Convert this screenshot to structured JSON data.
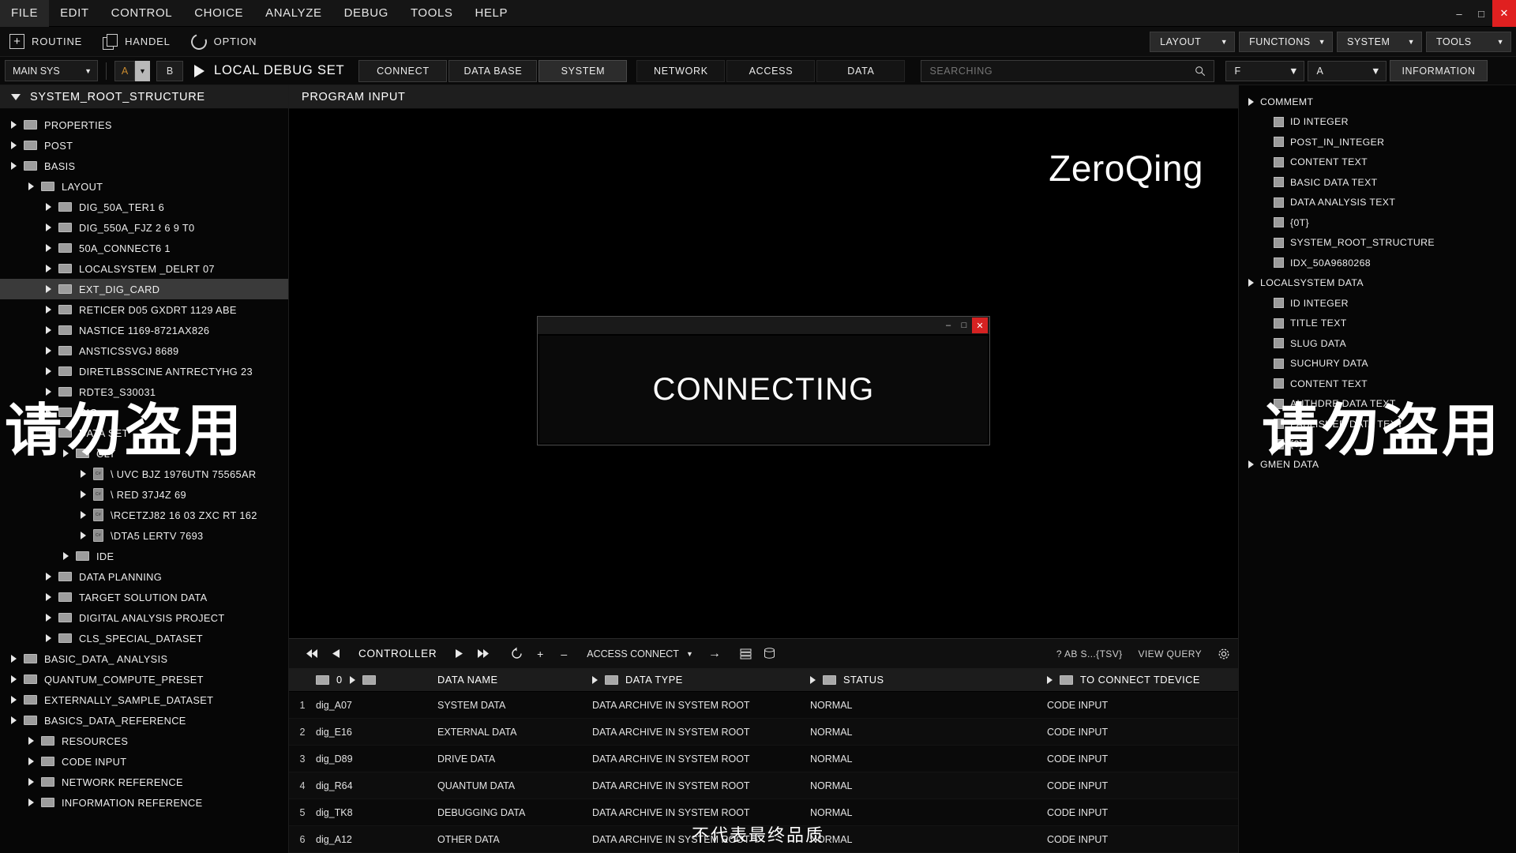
{
  "menubar": {
    "items": [
      "FILE",
      "EDIT",
      "CONTROL",
      "CHOICE",
      "ANALYZE",
      "DEBUG",
      "TOOLS",
      "HELP"
    ],
    "minimize": "–",
    "maximize": "□",
    "close": "✕"
  },
  "ribbon": {
    "groups": [
      {
        "icon": "plus-icon",
        "label": "ROUTINE"
      },
      {
        "icon": "copy-icon",
        "label": "HANDEL"
      },
      {
        "icon": "undo-icon",
        "label": "OPTION"
      }
    ],
    "plus_glyph": "+",
    "dropdowns": [
      "LAYOUT",
      "FUNCTIONS",
      "SYSTEM",
      "TOOLS"
    ],
    "caret": "▼"
  },
  "toolbar": {
    "main_select": "MAIN SYS",
    "channel_a": "A",
    "channel_b": "B",
    "run_label": "LOCAL DEBUG SET",
    "tabs": [
      {
        "label": "CONNECT",
        "selected": false
      },
      {
        "label": "DATA BASE",
        "selected": false
      },
      {
        "label": "SYSTEM",
        "selected": true
      },
      {
        "label": "NETWORK",
        "selected": false
      },
      {
        "label": "ACCESS",
        "selected": false
      },
      {
        "label": "DATA",
        "selected": false
      }
    ],
    "search_placeholder": "SEARCHING",
    "search_value": "",
    "select_f": "F",
    "select_a": "A",
    "information": "INFORMATION",
    "caret": "▼"
  },
  "left_panel": {
    "title": "SYSTEM_ROOT_STRUCTURE",
    "tree": [
      {
        "label": "PROPERTIES",
        "depth": 0,
        "type": "folder"
      },
      {
        "label": "POST",
        "depth": 0,
        "type": "folder"
      },
      {
        "label": "BASIS",
        "depth": 0,
        "type": "folder"
      },
      {
        "label": "LAYOUT",
        "depth": 1,
        "type": "folder"
      },
      {
        "label": "DIG_50A_TER1 6",
        "depth": 2,
        "type": "folder"
      },
      {
        "label": "DIG_550A_FJZ 2 6 9 T0",
        "depth": 2,
        "type": "folder"
      },
      {
        "label": "50A_CONNECT6 1",
        "depth": 2,
        "type": "folder"
      },
      {
        "label": "LOCALSYSTEM _DELRT 07",
        "depth": 2,
        "type": "folder"
      },
      {
        "label": "EXT_DIG_CARD",
        "depth": 2,
        "type": "folder",
        "selected": true
      },
      {
        "label": "RETICER D05 GXDRT 1129 ABE",
        "depth": 2,
        "type": "folder"
      },
      {
        "label": "NASTICE 1169-8721AX826",
        "depth": 2,
        "type": "folder"
      },
      {
        "label": "ANSTICSSVGJ 8689",
        "depth": 2,
        "type": "folder"
      },
      {
        "label": "DIRETLBSSCINE ANTRECTYHG 23",
        "depth": 2,
        "type": "folder"
      },
      {
        "label": "RDTE3_S30031",
        "depth": 2,
        "type": "folder"
      },
      {
        "label": "RIG",
        "depth": 2,
        "type": "folder"
      },
      {
        "label": "DATA SET",
        "depth": 2,
        "type": "folder"
      },
      {
        "label": "CLT",
        "depth": 3,
        "type": "folder"
      },
      {
        "label": "\\ UVC BJZ 1976UTN 75565AR",
        "depth": 4,
        "type": "file"
      },
      {
        "label": "\\ RED 37J4Z 69",
        "depth": 4,
        "type": "file"
      },
      {
        "label": "\\RCETZJ82 16 03 ZXC RT 162",
        "depth": 4,
        "type": "file"
      },
      {
        "label": "\\DTA5  LERTV 7693",
        "depth": 4,
        "type": "file"
      },
      {
        "label": "IDE",
        "depth": 3,
        "type": "folder"
      },
      {
        "label": "DATA PLANNING",
        "depth": 2,
        "type": "folder"
      },
      {
        "label": "TARGET SOLUTION DATA",
        "depth": 2,
        "type": "folder"
      },
      {
        "label": "DIGITAL ANALYSIS PROJECT",
        "depth": 2,
        "type": "folder"
      },
      {
        "label": "CLS_SPECIAL_DATASET",
        "depth": 2,
        "type": "folder"
      },
      {
        "label": "BASIC_DATA_ ANALYSIS",
        "depth": 0,
        "type": "folder"
      },
      {
        "label": "QUANTUM_COMPUTE_PRESET",
        "depth": 0,
        "type": "folder"
      },
      {
        "label": "EXTERNALLY_SAMPLE_DATASET",
        "depth": 0,
        "type": "folder"
      },
      {
        "label": "BASICS_DATA_REFERENCE",
        "depth": 0,
        "type": "folder"
      },
      {
        "label": "RESOURCES",
        "depth": 1,
        "type": "folder"
      },
      {
        "label": "CODE INPUT",
        "depth": 1,
        "type": "folder"
      },
      {
        "label": "NETWORK REFERENCE",
        "depth": 1,
        "type": "folder"
      },
      {
        "label": "INFORMATION REFERENCE",
        "depth": 1,
        "type": "folder"
      }
    ]
  },
  "center": {
    "title": "PROGRAM INPUT",
    "brand": "ZeroQing",
    "modal": {
      "text": "CONNECTING",
      "minimize": "–",
      "maximize": "□",
      "close": "✕"
    }
  },
  "controller": {
    "label": "CONTROLLER",
    "icons": [
      "skip-back-icon",
      "play-back-icon",
      "play-icon",
      "skip-forward-icon",
      "refresh-icon",
      "plus-icon",
      "minus-icon"
    ],
    "access_connect": "ACCESS CONNECT",
    "arrow": "→",
    "right_text": "? AB S...{TSV}",
    "view_query": "VIEW QUERY",
    "gear": "gear-icon"
  },
  "table": {
    "index_header": "0",
    "headers": [
      "DATA NAME",
      "DATA TYPE",
      "STATUS",
      "TO CONNECT TDEVICE"
    ],
    "rows": [
      {
        "idx": "1",
        "name": "dig_A07",
        "dataname": "SYSTEM DATA",
        "datatype": "DATA ARCHIVE  IN SYSTEM ROOT",
        "status": "NORMAL",
        "device": "CODE INPUT"
      },
      {
        "idx": "2",
        "name": "dig_E16",
        "dataname": "EXTERNAL DATA",
        "datatype": "DATA ARCHIVE  IN SYSTEM ROOT",
        "status": "NORMAL",
        "device": "CODE INPUT"
      },
      {
        "idx": "3",
        "name": "dig_D89",
        "dataname": "DRIVE DATA",
        "datatype": "DATA ARCHIVE  IN SYSTEM ROOT",
        "status": "NORMAL",
        "device": "CODE INPUT"
      },
      {
        "idx": "4",
        "name": "dig_R64",
        "dataname": "QUANTUM DATA",
        "datatype": "DATA ARCHIVE  IN SYSTEM ROOT",
        "status": "NORMAL",
        "device": "CODE INPUT"
      },
      {
        "idx": "5",
        "name": "dig_TK8",
        "dataname": "DEBUGGING DATA",
        "datatype": "DATA ARCHIVE  IN SYSTEM ROOT",
        "status": "NORMAL",
        "device": "CODE INPUT"
      },
      {
        "idx": "6",
        "name": "dig_A12",
        "dataname": "OTHER DATA",
        "datatype": "DATA ARCHIVE  IN SYSTEM ROOT",
        "status": "NORMAL",
        "device": "CODE INPUT"
      }
    ]
  },
  "right_panel": {
    "tree": [
      {
        "label": "COMMEMT",
        "depth": 0,
        "type": "group"
      },
      {
        "label": "ID INTEGER",
        "depth": 1,
        "type": "col"
      },
      {
        "label": "POST_IN_INTEGER",
        "depth": 1,
        "type": "col"
      },
      {
        "label": "CONTENT TEXT",
        "depth": 1,
        "type": "col"
      },
      {
        "label": "BASIC DATA TEXT",
        "depth": 1,
        "type": "col"
      },
      {
        "label": "DATA ANALYSIS TEXT",
        "depth": 1,
        "type": "col"
      },
      {
        "label": "{0T}",
        "depth": 1,
        "type": "col"
      },
      {
        "label": "SYSTEM_ROOT_STRUCTURE",
        "depth": 1,
        "type": "col"
      },
      {
        "label": "IDX_50A9680268",
        "depth": 1,
        "type": "col"
      },
      {
        "label": "LOCALSYSTEM DATA",
        "depth": 0,
        "type": "group"
      },
      {
        "label": "ID INTEGER",
        "depth": 1,
        "type": "col"
      },
      {
        "label": "TITLE TEXT",
        "depth": 1,
        "type": "col"
      },
      {
        "label": "SLUG DATA",
        "depth": 1,
        "type": "col"
      },
      {
        "label": "SUCHURY DATA",
        "depth": 1,
        "type": "col"
      },
      {
        "label": "CONTENT TEXT",
        "depth": 1,
        "type": "col"
      },
      {
        "label": "AUTHDRE DATA TEXT",
        "depth": 1,
        "type": "col"
      },
      {
        "label": "PABLISHED DATA TEXT",
        "depth": 1,
        "type": "col"
      },
      {
        "label": "{0}",
        "depth": 1,
        "type": "col"
      },
      {
        "label": "GMEN DATA",
        "depth": 0,
        "type": "group"
      }
    ]
  },
  "watermarks": {
    "left": "请勿盗用",
    "right": "请勿盗用",
    "bottom": "不代表最终品质"
  },
  "colors": {
    "accent_close": "#e02020",
    "channel_a": "#c98a2e",
    "panel_bg": "#060606",
    "header_bg": "#1e1e1e"
  }
}
